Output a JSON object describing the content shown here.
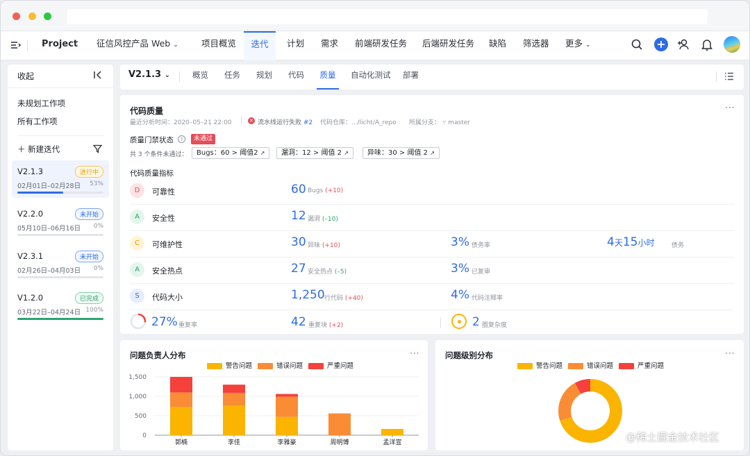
{
  "nav": {
    "project": "Project",
    "product": "征信风控产品 Web",
    "items": [
      "项目概览",
      "迭代",
      "计划",
      "需求",
      "前端研发任务",
      "后端研发任务",
      "缺陷",
      "筛选器",
      "更多"
    ]
  },
  "sidebar": {
    "collapse": "收起",
    "links": [
      "未规划工作项",
      "所有工作项"
    ],
    "new_iteration": "新建迭代",
    "iterations": [
      {
        "version": "V2.1.3",
        "status": "进行中",
        "dates": "02月01日–02月28日",
        "progress": "53%",
        "progress_value": 0.53
      },
      {
        "version": "V2.2.0",
        "status": "未开始",
        "dates": "05月10日–06月16日",
        "progress": "0%",
        "progress_value": 0
      },
      {
        "version": "V2.3.1",
        "status": "未开始",
        "dates": "02月26日–04月03日",
        "progress": "0%",
        "progress_value": 0
      },
      {
        "version": "V1.2.0",
        "status": "已完成",
        "dates": "03月22日–04月24日",
        "progress": "100%",
        "progress_value": 1
      }
    ]
  },
  "tabs": {
    "version": "V2.1.3",
    "items": [
      "概览",
      "任务",
      "规划",
      "代码",
      "质量",
      "自动化测试",
      "部署"
    ]
  },
  "quality": {
    "title": "代码质量",
    "last_analysis": "最近分析时间：2020–05–21 22:00",
    "pipeline": "流水线运行失败",
    "pipeline_num": "#2",
    "repo_label": "代码仓库：",
    "repo": ".../licht/A_repo",
    "branch_label": "所属分支：",
    "branch": "master",
    "gate_label": "质量门禁状态",
    "gate_status": "未通过",
    "failed_text": "共 3 个条件未通过：",
    "conditions": [
      "Bugs：60 > 阈值2",
      "漏洞：12 > 阈值 2",
      "异味：30 > 阈值 2"
    ],
    "metrics_title": "代码质量指标",
    "metrics": [
      {
        "grade": "D",
        "name": "可靠性",
        "v1": "60",
        "l1": "Bugs",
        "d1": "(+10)"
      },
      {
        "grade": "A",
        "name": "安全性",
        "v1": "12",
        "l1": "漏洞",
        "d1": "(–10)"
      },
      {
        "grade": "C",
        "name": "可维护性",
        "v1": "30",
        "l1": "异味",
        "d1": "(+10)",
        "v2": "3%",
        "l2": "债务率",
        "v3a": "4",
        "v3u1": "天",
        "v3b": "15",
        "v3u2": "小时",
        "l3": "债务"
      },
      {
        "grade": "A",
        "name": "安全热点",
        "v1": "27",
        "l1": "安全热点",
        "d1": "(–5)",
        "v2": "3%",
        "l2": "已复审"
      },
      {
        "grade": "S",
        "name": "代码大小",
        "v1": "1,250",
        "l1": "行代码",
        "d1": "(+40)",
        "v2": "4%",
        "l2": "代码注释率"
      }
    ],
    "dup_rate": "27%",
    "dup_rate_label": "重复率",
    "dup_rate_value": 0.27,
    "dup_blocks": "42",
    "dup_blocks_label": "重复块",
    "dup_blocks_delta": "(+2)",
    "complexity": "2",
    "complexity_label": "圈复杂度"
  },
  "colors": {
    "warning": "#fbb400",
    "error": "#fa8c35",
    "critical": "#f5403c"
  },
  "chart_data": [
    {
      "type": "bar",
      "title": "问题负责人分布",
      "stacked": true,
      "categories": [
        "郭楠",
        "李佳",
        "李雅豪",
        "周明博",
        "孟洋宣"
      ],
      "series": [
        {
          "name": "警告问题",
          "values": [
            720,
            760,
            470,
            0,
            160
          ]
        },
        {
          "name": "错误问题",
          "values": [
            380,
            330,
            520,
            560,
            0
          ]
        },
        {
          "name": "严重问题",
          "values": [
            400,
            210,
            70,
            0,
            0
          ]
        }
      ],
      "ylim": [
        0,
        1500
      ],
      "yticks": [
        "1,500",
        "1,000",
        "500",
        "0"
      ],
      "legend": "top"
    },
    {
      "type": "pie",
      "title": "问题级别分布",
      "donut": true,
      "labels": [
        "警告问题",
        "错误问题",
        "严重问题"
      ],
      "values": [
        70,
        22,
        8
      ],
      "legend": "top"
    }
  ],
  "watermark": "@稀土掘金技术社区"
}
